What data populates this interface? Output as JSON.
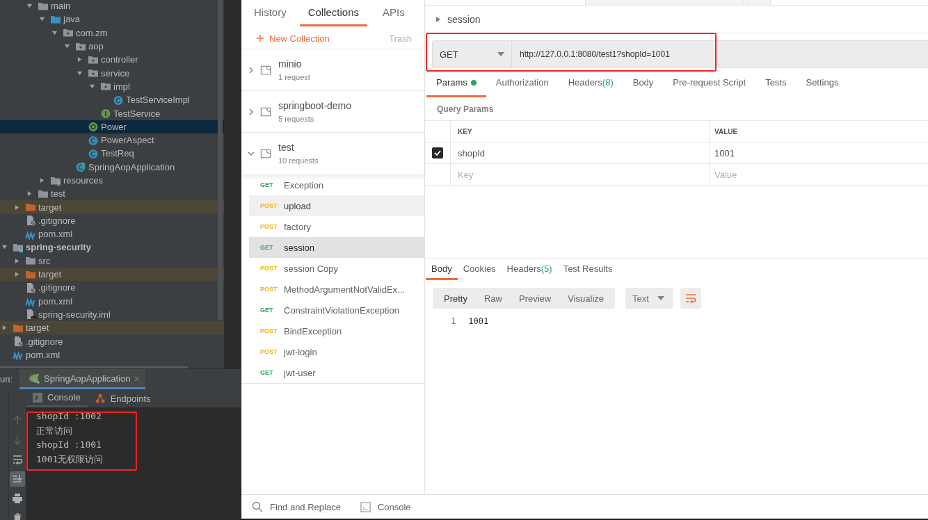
{
  "ide": {
    "tree": [
      {
        "children": [
          {
            "children": [
              {
                "label": "main",
                "kind": "folder",
                "expanded": true,
                "selected": false,
                "children": [
                  {
                    "label": "java",
                    "kind": "source-folder",
                    "expanded": true,
                    "selected": false,
                    "children": [
                      {
                        "label": "com.zm",
                        "kind": "package",
                        "expanded": true,
                        "selected": false,
                        "children": [
                          {
                            "label": "aop",
                            "kind": "package",
                            "expanded": true,
                            "selected": false,
                            "children": [
                              {
                                "label": "controller",
                                "kind": "package",
                                "expanded": false,
                                "selected": false
                              },
                              {
                                "label": "service",
                                "kind": "package",
                                "expanded": true,
                                "selected": false,
                                "children": [
                                  {
                                    "label": "impl",
                                    "kind": "package",
                                    "expanded": true,
                                    "selected": false,
                                    "children": [
                                      {
                                        "label": "TestServiceImpl",
                                        "kind": "class",
                                        "selected": false
                                      }
                                    ]
                                  },
                                  {
                                    "label": "TestService",
                                    "kind": "interface",
                                    "selected": false
                                  }
                                ]
                              },
                              {
                                "label": "Power",
                                "kind": "annotation",
                                "selected": true
                              },
                              {
                                "label": "PowerAspect",
                                "kind": "class",
                                "selected": false
                              },
                              {
                                "label": "TestReq",
                                "kind": "class",
                                "selected": false
                              }
                            ]
                          },
                          {
                            "label": "SpringAopApplication",
                            "kind": "app",
                            "selected": false
                          }
                        ]
                      }
                    ]
                  },
                  {
                    "label": "resources",
                    "kind": "resources",
                    "expanded": false,
                    "selected": false
                  }
                ]
              },
              {
                "label": "test",
                "kind": "folder",
                "expanded": false,
                "selected": false
              }
            ]
          },
          {
            "label": "target",
            "kind": "excluded-folder",
            "expanded": false,
            "selected": false
          },
          {
            "label": ".gitignore",
            "kind": "gitignore",
            "selected": false
          },
          {
            "label": "pom.xml",
            "kind": "maven",
            "selected": false
          }
        ]
      },
      {
        "label": "spring-security",
        "kind": "module",
        "expanded": true,
        "selected": false,
        "children": [
          {
            "label": "src",
            "kind": "folder",
            "expanded": false,
            "selected": false
          },
          {
            "label": "target",
            "kind": "excluded-folder",
            "expanded": false,
            "selected": false
          },
          {
            "label": ".gitignore",
            "kind": "gitignore",
            "selected": false
          },
          {
            "label": "pom.xml",
            "kind": "maven",
            "selected": false
          },
          {
            "label": "spring-security.iml",
            "kind": "iml",
            "selected": false
          }
        ]
      },
      {
        "label": "target",
        "kind": "excluded-folder",
        "expanded": false,
        "selected": false
      },
      {
        "label": ".gitignore",
        "kind": "gitignore",
        "selected": false
      },
      {
        "label": "pom.xml",
        "kind": "maven",
        "selected": false
      }
    ],
    "run": {
      "label": "un:",
      "tab": "SpringAopApplication",
      "close": "×"
    },
    "console_tabs": [
      {
        "label": "Console",
        "kind": "console",
        "selected": true
      },
      {
        "label": "Endpoints",
        "kind": "endpoints",
        "selected": false
      }
    ],
    "console_tools": [
      {
        "kind": "up",
        "selected": false
      },
      {
        "kind": "down",
        "selected": false
      },
      {
        "kind": "wrap",
        "selected": false
      },
      {
        "kind": "scroll-end",
        "selected": true
      },
      {
        "kind": "print",
        "selected": false
      },
      {
        "kind": "trash",
        "selected": false
      }
    ],
    "console": {
      "highlighted": true,
      "lines": [
        "shopId :1002",
        "正常访问",
        "shopId :1001",
        "1001无权限访问"
      ]
    }
  },
  "postman": {
    "sidebar_tabs": [
      {
        "label": "History",
        "selected": false
      },
      {
        "label": "Collections",
        "selected": true
      },
      {
        "label": "APIs",
        "selected": false
      }
    ],
    "new_collection": "New Collection",
    "trash": "Trash",
    "collections": [
      {
        "name": "minio",
        "count": "1 request",
        "expanded": false
      },
      {
        "name": "springboot-demo",
        "count": "5 requests",
        "expanded": false
      },
      {
        "name": "test",
        "count": "10 requests",
        "expanded": true,
        "requests": [
          {
            "method": "GET",
            "color": "#26a65b",
            "name": "Exception",
            "hovered": false,
            "selected": false
          },
          {
            "method": "POST",
            "color": "#f5b400",
            "name": "upload",
            "hovered": true,
            "selected": false
          },
          {
            "method": "POST",
            "color": "#f5b400",
            "name": "factory",
            "hovered": false,
            "selected": false
          },
          {
            "method": "GET",
            "color": "#26a65b",
            "name": "session",
            "hovered": false,
            "selected": true
          },
          {
            "method": "POST",
            "color": "#f5b400",
            "name": "session Copy",
            "hovered": false,
            "selected": false
          },
          {
            "method": "POST",
            "color": "#f5b400",
            "name": "MethodArgumentNotValidEx...",
            "hovered": false,
            "selected": false
          },
          {
            "method": "GET",
            "color": "#26a65b",
            "name": "ConstraintViolationException",
            "hovered": false,
            "selected": false
          },
          {
            "method": "POST",
            "color": "#f5b400",
            "name": "BindException",
            "hovered": false,
            "selected": false
          },
          {
            "method": "POST",
            "color": "#f5b400",
            "name": "jwt-login",
            "hovered": false,
            "selected": false
          },
          {
            "method": "GET",
            "color": "#26a65b",
            "name": "jwt-user",
            "hovered": false,
            "selected": false
          }
        ]
      }
    ],
    "breadcrumb": "session",
    "request": {
      "method": "GET",
      "url": "http://127.0.0.1:8080/test1?shopId=1001",
      "highlighted": true
    },
    "request_tabs": [
      {
        "label": "Params",
        "selected": true,
        "indicator": true
      },
      {
        "label": "Authorization",
        "selected": false,
        "indicator": false
      },
      {
        "label": "Headers",
        "count": "(8)",
        "selected": false,
        "indicator": false
      },
      {
        "label": "Body",
        "selected": false,
        "indicator": false
      },
      {
        "label": "Pre-request Script",
        "selected": false,
        "indicator": false
      },
      {
        "label": "Tests",
        "selected": false,
        "indicator": false
      },
      {
        "label": "Settings",
        "selected": false,
        "indicator": false
      }
    ],
    "query_params": {
      "title": "Query Params",
      "columns": [
        "KEY",
        "VALUE"
      ],
      "rows": [
        {
          "key": "shopId",
          "value": "1001",
          "checked": true
        }
      ],
      "empty_row": {
        "key": {
          "placeholder": "Key"
        },
        "value": {
          "placeholder": "Value"
        }
      }
    },
    "response_tabs": [
      {
        "label": "Body",
        "selected": true
      },
      {
        "label": "Cookies",
        "selected": false
      },
      {
        "label": "Headers",
        "count": "(5)",
        "selected": false
      },
      {
        "label": "Test Results",
        "selected": false
      }
    ],
    "view_modes": [
      {
        "label": "Pretty",
        "selected": true
      },
      {
        "label": "Raw",
        "selected": false
      },
      {
        "label": "Preview",
        "selected": false
      },
      {
        "label": "Visualize",
        "selected": false
      }
    ],
    "format": "Text",
    "response_lines": [
      {
        "number": "1",
        "text": "1001"
      }
    ],
    "footer": [
      {
        "label": "Find and Replace",
        "kind": "search"
      },
      {
        "label": "Console",
        "kind": "console"
      }
    ]
  }
}
